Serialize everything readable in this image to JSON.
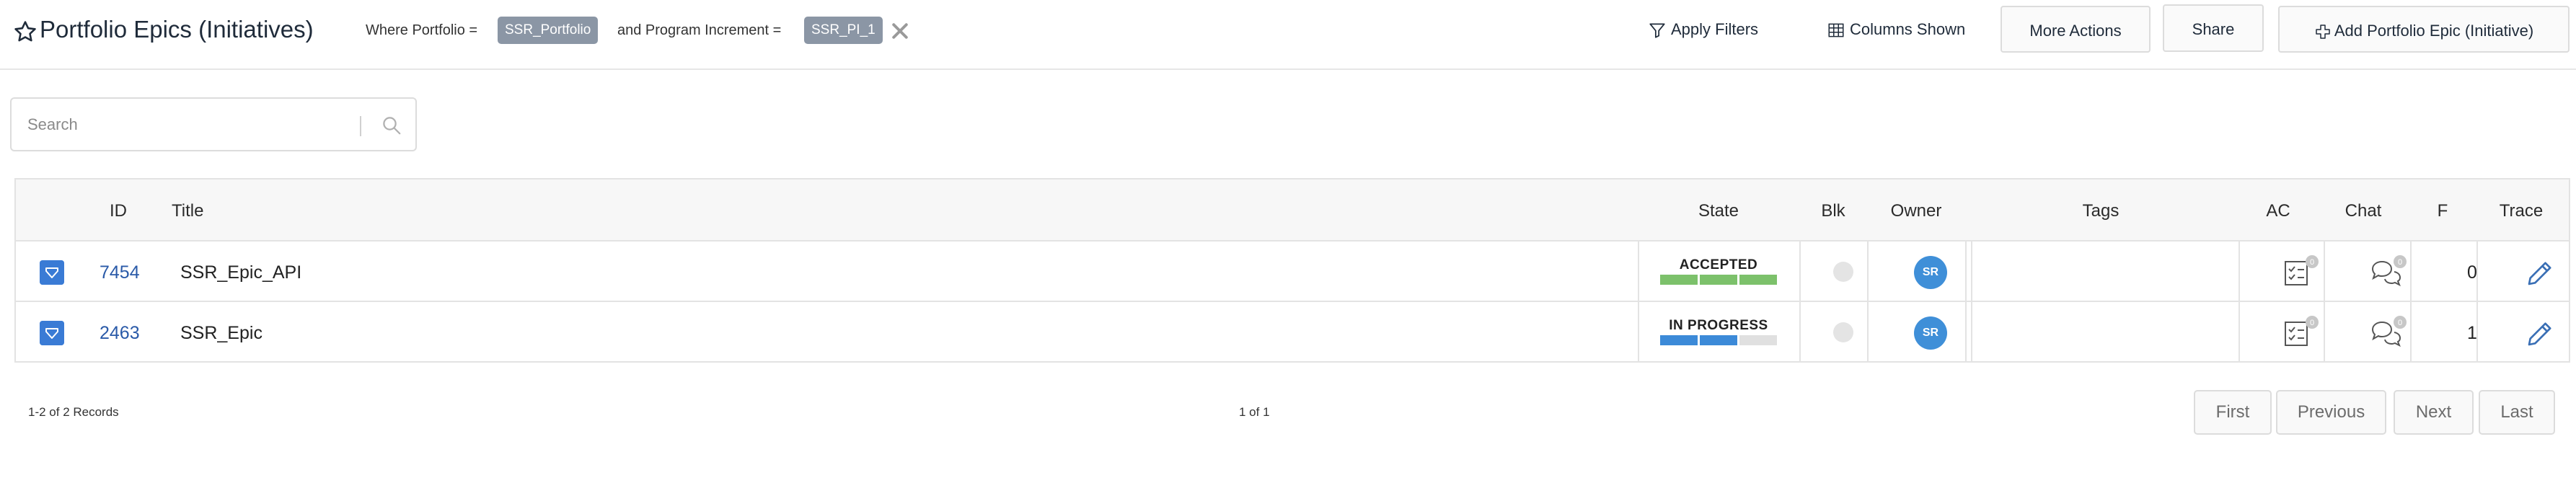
{
  "header": {
    "title": "Portfolio Epics (Initiatives)",
    "filter": {
      "portfolio_label": "Where Portfolio =",
      "portfolio_value": "SSR_Portfolio",
      "pi_label": "and Program Increment =",
      "pi_value": "SSR_PI_1"
    },
    "apply_filters": "Apply Filters",
    "columns_shown": "Columns Shown",
    "more_actions": "More Actions",
    "share": "Share",
    "add_epic": "Add Portfolio Epic (Initiative)"
  },
  "search": {
    "placeholder": "Search",
    "value": ""
  },
  "table": {
    "columns": {
      "id": "ID",
      "title": "Title",
      "state": "State",
      "blk": "Blk",
      "owner": "Owner",
      "tags": "Tags",
      "ac": "AC",
      "chat": "Chat",
      "f": "F",
      "trace": "Trace"
    },
    "rows": [
      {
        "id": "7454",
        "title": "SSR_Epic_API",
        "state": "ACCEPTED",
        "state_color": "#7cc16b",
        "state_progress": 1.0,
        "owner": "SR",
        "ac_count": "0",
        "chat_count": "0",
        "f": "0"
      },
      {
        "id": "2463",
        "title": "SSR_Epic",
        "state": "IN PROGRESS",
        "state_color": "#3c8ad8",
        "state_progress": 0.67,
        "owner": "SR",
        "ac_count": "0",
        "chat_count": "0",
        "f": "1"
      }
    ]
  },
  "footer": {
    "records": "1-2 of 2 Records",
    "page_info": "1 of 1",
    "first": "First",
    "previous": "Previous",
    "next": "Next",
    "last": "Last"
  },
  "colors": {
    "accent": "#3a7bd5",
    "link": "#2a5aa8",
    "chip": "#8b96a5",
    "avatar": "#3f8fd8"
  },
  "icons": {
    "title": "star-icon",
    "apply_filters": "filter-icon",
    "columns_shown": "columns-icon",
    "add": "plus-icon",
    "search": "search-icon",
    "clear": "close-icon",
    "row_type": "epic-icon",
    "ac": "checklist-icon",
    "chat": "chat-icon",
    "trace": "pencil-icon"
  }
}
